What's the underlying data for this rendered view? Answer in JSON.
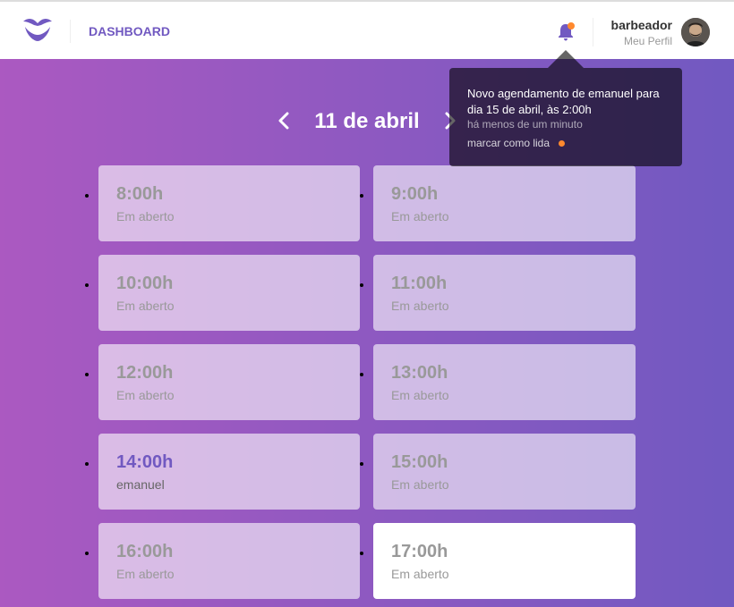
{
  "header": {
    "logo_icon": "mustache-logo-icon",
    "nav_label": "DASHBOARD",
    "notification_icon": "bell-icon",
    "profile": {
      "name": "barbeador",
      "link_label": "Meu Perfil"
    }
  },
  "notification": {
    "message": "Novo agendamento de emanuel para dia 15 de abril, às 2:00h",
    "time_ago": "há menos de um minuto",
    "mark_read_label": "marcar como lida"
  },
  "date_nav": {
    "prev_icon": "chevron-left-icon",
    "next_icon": "chevron-right-icon",
    "current_date": "11 de abril"
  },
  "schedule": [
    {
      "time": "8:00h",
      "client": "Em aberto",
      "state": "past"
    },
    {
      "time": "9:00h",
      "client": "Em aberto",
      "state": "past"
    },
    {
      "time": "10:00h",
      "client": "Em aberto",
      "state": "past"
    },
    {
      "time": "11:00h",
      "client": "Em aberto",
      "state": "past"
    },
    {
      "time": "12:00h",
      "client": "Em aberto",
      "state": "past"
    },
    {
      "time": "13:00h",
      "client": "Em aberto",
      "state": "past"
    },
    {
      "time": "14:00h",
      "client": "emanuel",
      "state": "booked"
    },
    {
      "time": "15:00h",
      "client": "Em aberto",
      "state": "past"
    },
    {
      "time": "16:00h",
      "client": "Em aberto",
      "state": "past"
    },
    {
      "time": "17:00h",
      "client": "Em aberto",
      "state": "available"
    }
  ],
  "colors": {
    "brand": "#7159c1",
    "gradient_end": "#ab59c1",
    "badge": "#ff892e"
  }
}
